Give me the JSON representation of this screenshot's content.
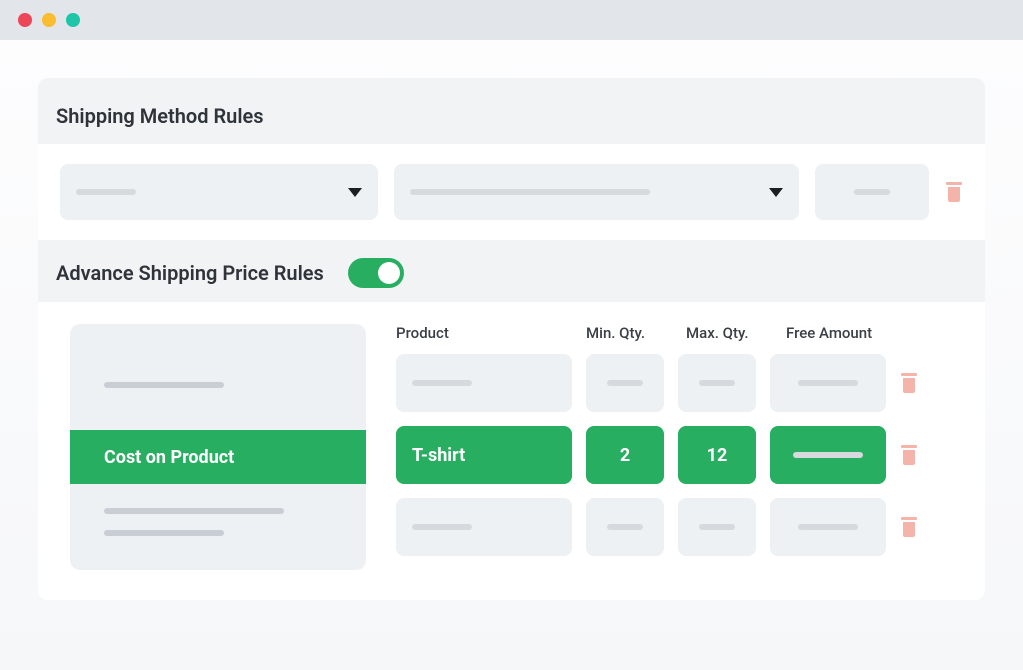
{
  "titlebar": {
    "dots": [
      "red",
      "yellow",
      "green"
    ]
  },
  "shipping_method": {
    "title": "Shipping Method Rules"
  },
  "advance": {
    "title": "Advance Shipping Price Rules",
    "toggle_on": true,
    "menu": {
      "active_label": "Cost on Product"
    },
    "columns": {
      "product": "Product",
      "min_qty": "Min. Qty.",
      "max_qty": "Max. Qty.",
      "free_amount": "Free Amount"
    },
    "rows": [
      {
        "product": "",
        "min_qty": "",
        "max_qty": "",
        "free_amount": "",
        "highlighted": false
      },
      {
        "product": "T-shirt",
        "min_qty": "2",
        "max_qty": "12",
        "free_amount": "",
        "highlighted": true
      },
      {
        "product": "",
        "min_qty": "",
        "max_qty": "",
        "free_amount": "",
        "highlighted": false
      }
    ]
  },
  "colors": {
    "accent": "#27ae60",
    "trash": "#f4b4aa",
    "panel": "#f1f3f5",
    "cell": "#eef1f4"
  }
}
